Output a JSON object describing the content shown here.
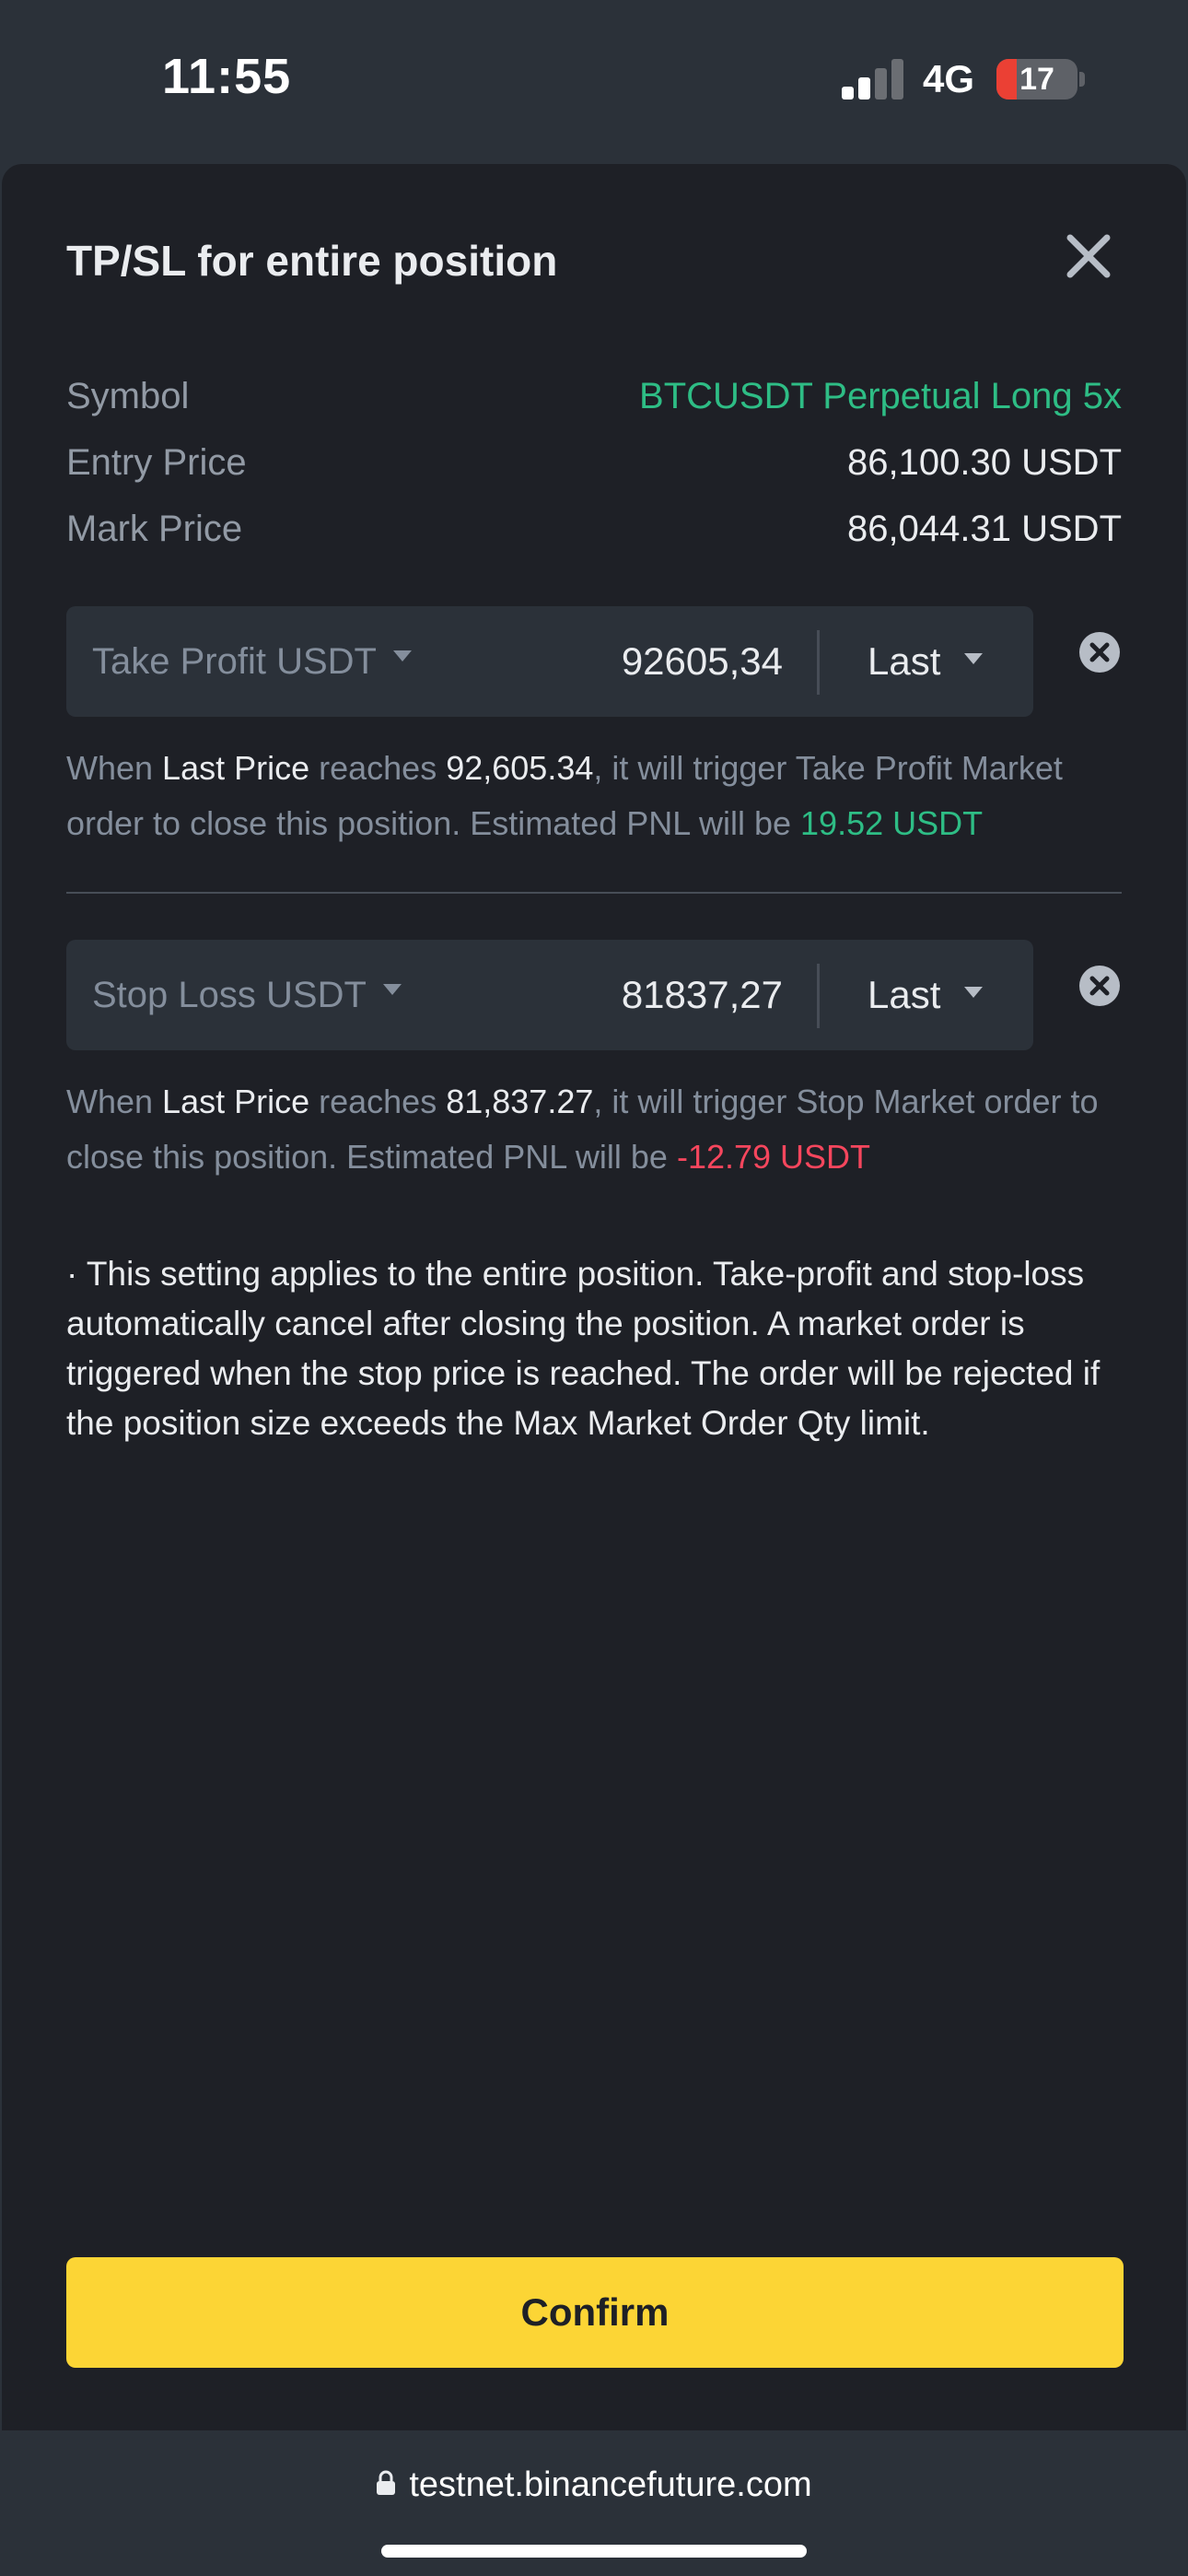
{
  "status_bar": {
    "time": "11:55",
    "network": "4G",
    "battery_level": "17",
    "battery_fraction": 0.17,
    "signal_bars_active": 2,
    "signal_bars_total": 4
  },
  "sheet": {
    "title": "TP/SL for entire position",
    "close_icon": "close-icon"
  },
  "info": {
    "symbol_label": "Symbol",
    "symbol_value": "BTCUSDT Perpetual Long 5x",
    "entry_label": "Entry Price",
    "entry_value": "86,100.30 USDT",
    "mark_label": "Mark Price",
    "mark_value": "86,044.31 USDT"
  },
  "take_profit": {
    "label": "Take Profit USDT",
    "value": "92605,34",
    "type": "Last",
    "desc_1": "When ",
    "desc_price_type": "Last Price",
    "desc_2": " reaches ",
    "desc_price": "92,605.34",
    "desc_3": ", it will trigger Take Profit Market order to close this position. Estimated PNL will be ",
    "desc_pnl": "19.52 USDT"
  },
  "stop_loss": {
    "label": "Stop Loss USDT",
    "value": "81837,27",
    "type": "Last",
    "desc_1": "When ",
    "desc_price_type": "Last Price",
    "desc_2": " reaches ",
    "desc_price": "81,837.27",
    "desc_3": ", it will trigger Stop Market order to close this position. Estimated PNL will be ",
    "desc_pnl": "-12.79 USDT"
  },
  "note": "· This setting applies to the entire position. Take-profit and stop-loss automatically cancel after closing the position. A market order is triggered when the stop price is reached. The order will be rejected if the position size exceeds the Max Market Order Qty limit.",
  "confirm_label": "Confirm",
  "browser": {
    "url": "testnet.binancefuture.com"
  },
  "colors": {
    "accent": "#fcd535",
    "profit": "#2ebd85",
    "loss": "#f6465d",
    "sheet_bg": "#1e2026",
    "input_bg": "#2b3139"
  }
}
